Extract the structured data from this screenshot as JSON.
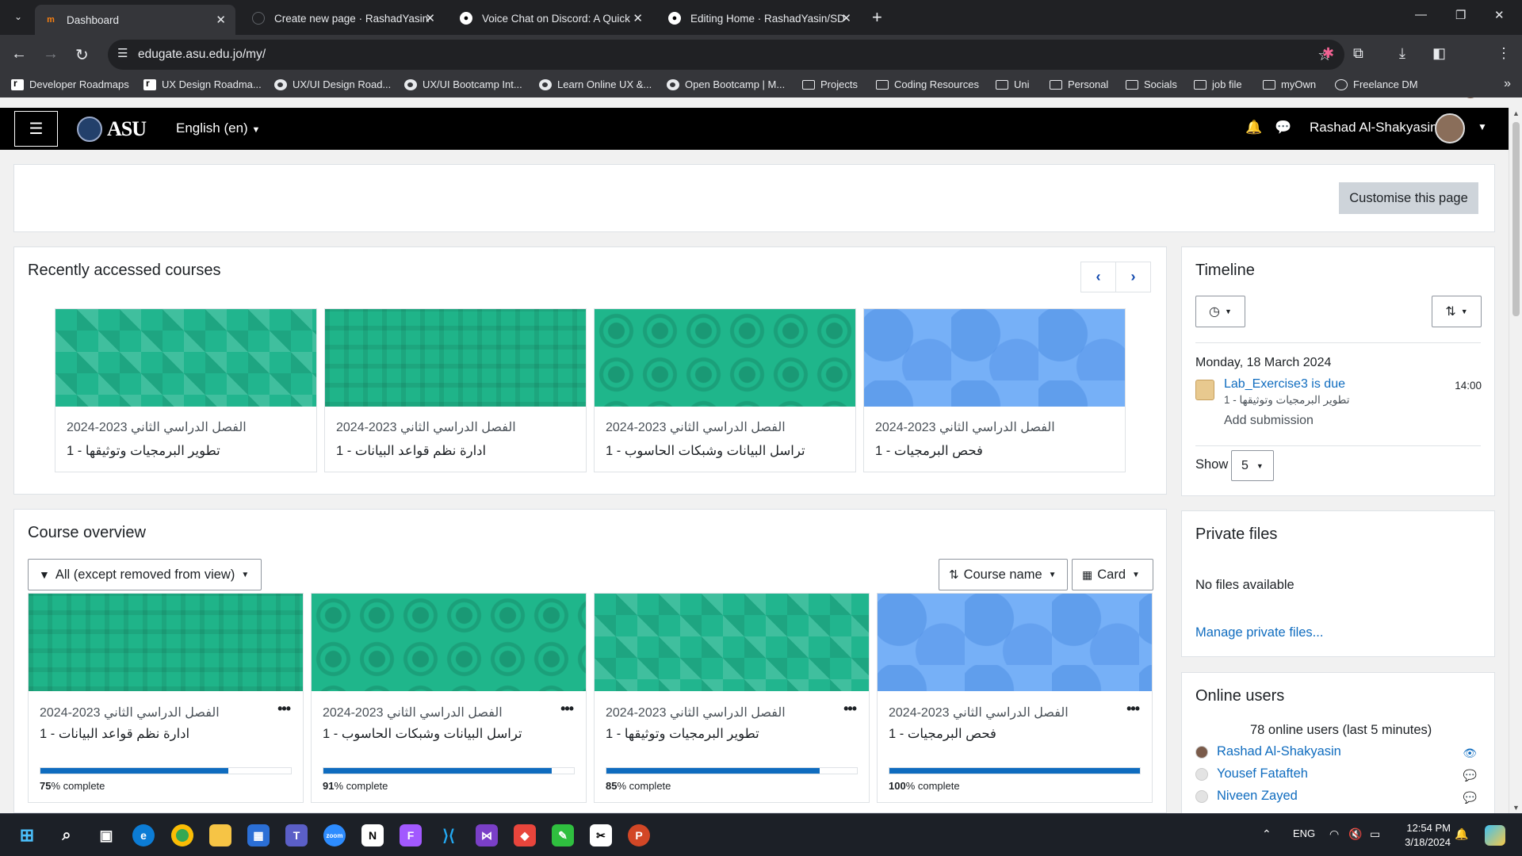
{
  "browser": {
    "tabs": [
      {
        "title": "Dashboard",
        "active": true
      },
      {
        "title": "Create new page · RashadYasin/",
        "active": false
      },
      {
        "title": "Voice Chat on Discord: A Quick",
        "active": false
      },
      {
        "title": "Editing Home · RashadYasin/SD",
        "active": false
      }
    ],
    "url": "edugate.asu.edu.jo/my/",
    "bookmarks": [
      {
        "label": "Developer Roadmaps",
        "icon": "roadmap-icon"
      },
      {
        "label": "UX Design Roadma...",
        "icon": "roadmap-icon"
      },
      {
        "label": "UX/UI Design Road...",
        "icon": "openai-icon"
      },
      {
        "label": "UX/UI Bootcamp Int...",
        "icon": "openai-icon"
      },
      {
        "label": "Learn Online UX &...",
        "icon": "openai-icon"
      },
      {
        "label": "Open Bootcamp | M...",
        "icon": "openai-icon"
      },
      {
        "label": "Projects",
        "icon": "folder-icon"
      },
      {
        "label": "Coding Resources",
        "icon": "folder-icon"
      },
      {
        "label": "Uni",
        "icon": "folder-icon"
      },
      {
        "label": "Personal",
        "icon": "folder-icon"
      },
      {
        "label": "Socials",
        "icon": "folder-icon"
      },
      {
        "label": "job file",
        "icon": "folder-icon"
      },
      {
        "label": "myOwn",
        "icon": "folder-icon"
      },
      {
        "label": "Freelance DM",
        "icon": "globe-icon"
      }
    ]
  },
  "moodle": {
    "logo_text": "ASU",
    "language": "English (en)",
    "user_name": "Rashad Al-Shakyasin",
    "customise_label": "Customise this page"
  },
  "recent": {
    "title": "Recently accessed courses",
    "courses": [
      {
        "category": "الفصل الدراسي الثاني 2023-2024",
        "name": "تطوير البرمجيات وتوثيقها - 1",
        "pattern": "diamond"
      },
      {
        "category": "الفصل الدراسي الثاني 2023-2024",
        "name": "ادارة نظم قواعد البيانات - 1",
        "pattern": "squares"
      },
      {
        "category": "الفصل الدراسي الثاني 2023-2024",
        "name": "تراسل البيانات وشبكات الحاسوب - 1",
        "pattern": "circles"
      },
      {
        "category": "الفصل الدراسي الثاني 2023-2024",
        "name": "فحص البرمجيات - 1",
        "pattern": "hex"
      }
    ]
  },
  "overview": {
    "title": "Course overview",
    "filter_label": "All (except removed from view)",
    "sort_label": "Course name",
    "view_label": "Card",
    "complete_suffix": "% complete",
    "courses": [
      {
        "category": "الفصل الدراسي الثاني 2023-2024",
        "name": "ادارة نظم قواعد البيانات - 1",
        "progress": 75,
        "pattern": "squares"
      },
      {
        "category": "الفصل الدراسي الثاني 2023-2024",
        "name": "تراسل البيانات وشبكات الحاسوب - 1",
        "progress": 91,
        "pattern": "circles"
      },
      {
        "category": "الفصل الدراسي الثاني 2023-2024",
        "name": "تطوير البرمجيات وتوثيقها - 1",
        "progress": 85,
        "pattern": "diamond"
      },
      {
        "category": "الفصل الدراسي الثاني 2023-2024",
        "name": "فحص البرمجيات - 1",
        "progress": 100,
        "pattern": "hex"
      }
    ]
  },
  "timeline": {
    "title": "Timeline",
    "date": "Monday, 18 March 2024",
    "event_name": "Lab_Exercise3 is due",
    "event_course": "تطوير البرمجيات وتوثيقها - 1",
    "event_time": "14:00",
    "action": "Add submission",
    "show_label": "Show",
    "show_value": "5"
  },
  "private_files": {
    "title": "Private files",
    "empty": "No files available",
    "manage_link": "Manage private files..."
  },
  "online_users": {
    "title": "Online users",
    "count": "78 online users (last 5 minutes)",
    "users": [
      "Rashad Al-Shakyasin",
      "Yousef Fatafteh",
      "Niveen Zayed"
    ]
  },
  "taskbar": {
    "lang": "ENG",
    "time": "12:54 PM",
    "date": "3/18/2024"
  },
  "colors": {
    "link": "#0f6cbf",
    "progress": "#0f6cbf",
    "navbar": "#000000"
  }
}
